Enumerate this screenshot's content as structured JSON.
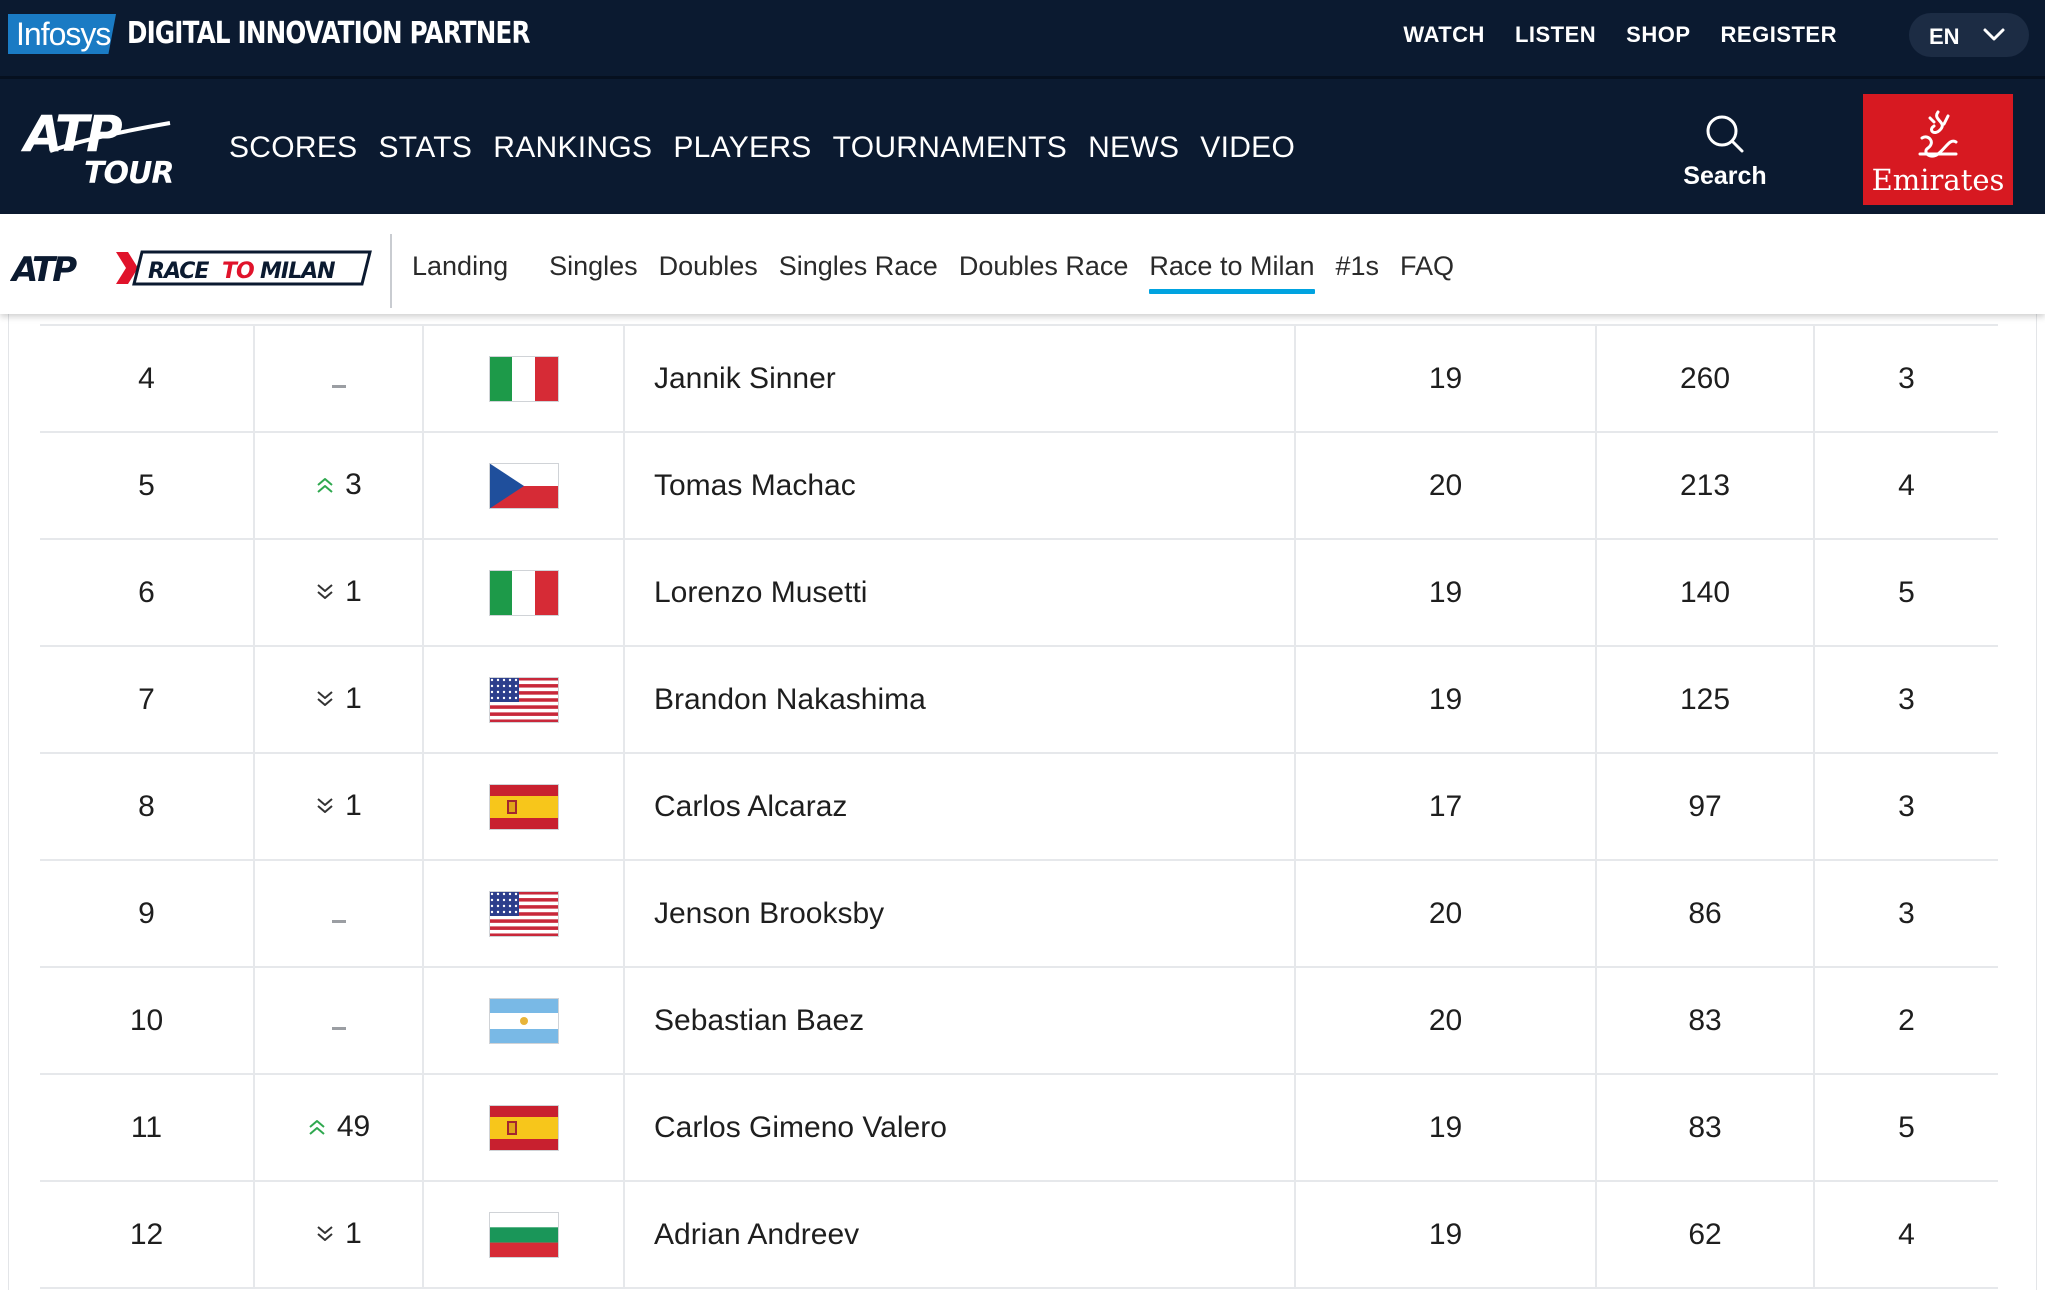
{
  "partner": {
    "brand": "Infosys",
    "label": "DIGITAL INNOVATION PARTNER"
  },
  "top_links": [
    "WATCH",
    "LISTEN",
    "SHOP",
    "REGISTER"
  ],
  "language": "EN",
  "main_nav": {
    "logo_text": "ATP TOUR",
    "links": [
      "SCORES",
      "STATS",
      "RANKINGS",
      "PLAYERS",
      "TOURNAMENTS",
      "NEWS",
      "VIDEO"
    ],
    "search_label": "Search",
    "sponsor": "Emirates"
  },
  "sub_nav": {
    "logo_text": "RACE TO MILAN",
    "tabs": [
      "Landing",
      "Singles",
      "Doubles",
      "Singles Race",
      "Doubles Race",
      "Race to Milan",
      "#1s",
      "FAQ"
    ],
    "active_tab": "Race to Milan"
  },
  "colors": {
    "navy": "#0b1a30",
    "accent_blue": "#00a3e0",
    "emirates_red": "#d71921",
    "up_green": "#2fa84f",
    "down_dark": "#333333"
  },
  "rankings": [
    {
      "rank": "4",
      "move": "–",
      "move_dir": "none",
      "flag": "ITA",
      "name": "Jannik Sinner",
      "age": "19",
      "points": "260",
      "tournaments": "3"
    },
    {
      "rank": "5",
      "move": "3",
      "move_dir": "up",
      "flag": "CZE",
      "name": "Tomas Machac",
      "age": "20",
      "points": "213",
      "tournaments": "4"
    },
    {
      "rank": "6",
      "move": "1",
      "move_dir": "down",
      "flag": "ITA",
      "name": "Lorenzo Musetti",
      "age": "19",
      "points": "140",
      "tournaments": "5"
    },
    {
      "rank": "7",
      "move": "1",
      "move_dir": "down",
      "flag": "USA",
      "name": "Brandon Nakashima",
      "age": "19",
      "points": "125",
      "tournaments": "3"
    },
    {
      "rank": "8",
      "move": "1",
      "move_dir": "down",
      "flag": "ESP",
      "name": "Carlos Alcaraz",
      "age": "17",
      "points": "97",
      "tournaments": "3"
    },
    {
      "rank": "9",
      "move": "–",
      "move_dir": "none",
      "flag": "USA",
      "name": "Jenson Brooksby",
      "age": "20",
      "points": "86",
      "tournaments": "3"
    },
    {
      "rank": "10",
      "move": "–",
      "move_dir": "none",
      "flag": "ARG",
      "name": "Sebastian Baez",
      "age": "20",
      "points": "83",
      "tournaments": "2"
    },
    {
      "rank": "11",
      "move": "49",
      "move_dir": "up",
      "flag": "ESP",
      "name": "Carlos Gimeno Valero",
      "age": "19",
      "points": "83",
      "tournaments": "5"
    },
    {
      "rank": "12",
      "move": "1",
      "move_dir": "down",
      "flag": "BUL",
      "name": "Adrian Andreev",
      "age": "19",
      "points": "62",
      "tournaments": "4"
    }
  ]
}
